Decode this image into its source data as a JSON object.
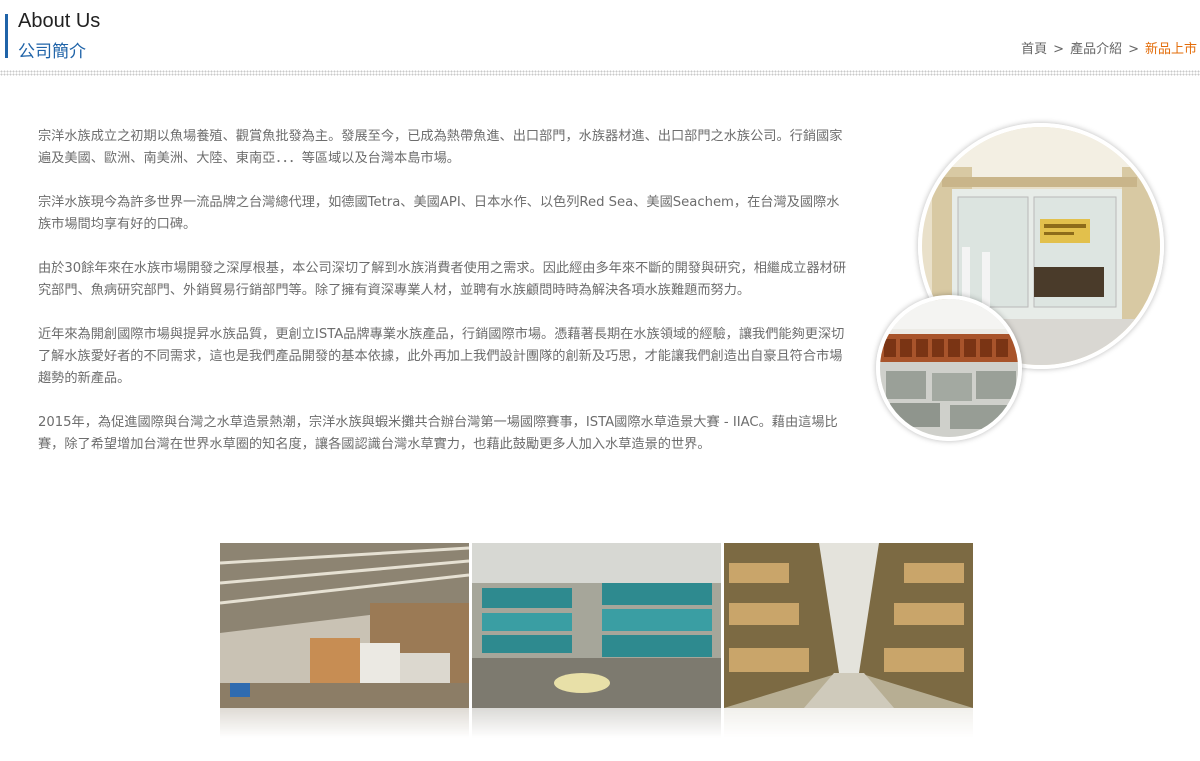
{
  "header": {
    "title_en": "About Us",
    "title_zh": "公司簡介"
  },
  "breadcrumb": {
    "items": [
      "首頁",
      "產品介紹",
      "新品上市"
    ],
    "separator": ">"
  },
  "body": {
    "paragraphs": [
      "宗洋水族成立之初期以魚場養殖、觀賞魚批發為主。發展至今，已成為熱帶魚進、出口部門，水族器材進、出口部門之水族公司。行銷國家遍及美國、歐洲、南美洲、大陸、東南亞．．．等區域以及台灣本島市場。",
      "宗洋水族現今為許多世界一流品牌之台灣總代理，如德國Tetra、美國API、日本水作、以色列Red Sea、美國Seachem，在台灣及國際水族市場間均享有好的口碑。",
      "由於30餘年來在水族市場開發之深厚根基，本公司深切了解到水族消費者使用之需求。因此經由多年來不斷的開發與研究，相繼成立器材研究部門、魚病研究部門、外銷貿易行銷部門等。除了擁有資深專業人材，並聘有水族顧問時時為解決各項水族難題而努力。",
      "近年來為開創國際市場與提昇水族品質，更創立ISTA品牌專業水族產品，行銷國際市場。憑藉著長期在水族領域的經驗，讓我們能夠更深切了解水族愛好者的不同需求，這也是我們產品開發的基本依據，此外再加上我們設計團隊的創新及巧思，才能讓我們創造出自豪且符合市場趨勢的新產品。",
      "2015年，為促進國際與台灣之水草造景熱潮，宗洋水族與蝦米攤共合辦台灣第一場國際賽事，ISTA國際水草造景大賽 - IIAC。藉由這場比賽，除了希望增加台灣在世界水草圈的知名度，讓各國認識台灣水草實力，也藉此鼓勵更多人加入水草造景的世界。"
    ]
  },
  "colors": {
    "accent_blue": "#1f63a8",
    "breadcrumb_current": "#e36c09",
    "body_text": "#6d6d6d"
  }
}
